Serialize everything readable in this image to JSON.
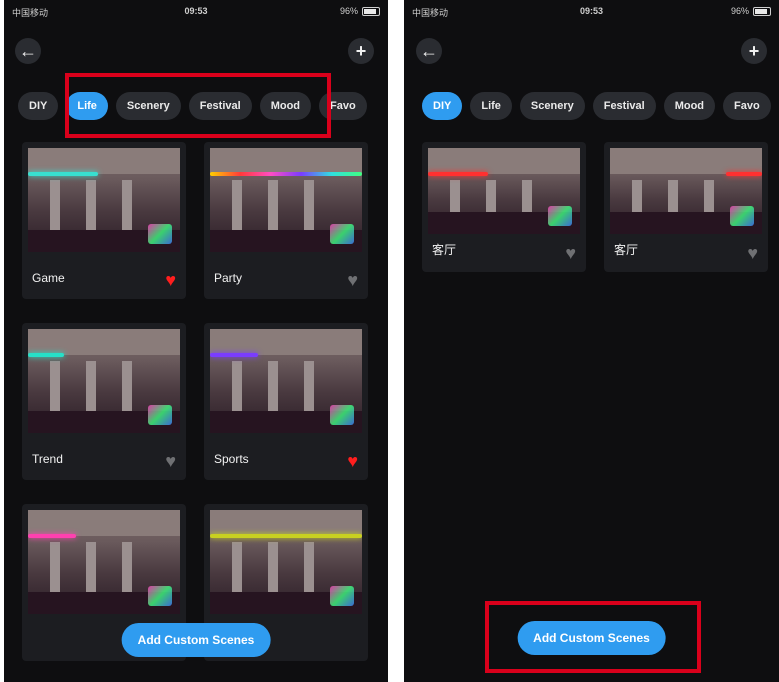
{
  "status_bar": {
    "carrier": "中国移动",
    "time": "09:53",
    "battery": "96%"
  },
  "header": {
    "back_icon": "←",
    "add_icon": "+"
  },
  "tabs": [
    "DIY",
    "Life",
    "Scenery",
    "Festival",
    "Mood",
    "Favo"
  ],
  "left_screen": {
    "active_tab": "Life",
    "scenes": [
      {
        "label": "Game",
        "favorite": true,
        "strip_color": "#38e0d0"
      },
      {
        "label": "Party",
        "favorite": false,
        "strip_color": "#ff4dc4"
      },
      {
        "label": "Trend",
        "favorite": false,
        "strip_color": "#26e0c8"
      },
      {
        "label": "Sports",
        "favorite": true,
        "strip_color": "#7a3cff"
      },
      {
        "label": "",
        "favorite": false,
        "strip_color": "#ff40b0"
      },
      {
        "label": "",
        "favorite": false,
        "strip_color": "#c8d020"
      }
    ],
    "add_button": "Add Custom Scenes"
  },
  "right_screen": {
    "active_tab": "DIY",
    "scenes": [
      {
        "label": "客厅",
        "favorite": false,
        "strip_color": "#ff3030"
      },
      {
        "label": "客厅",
        "favorite": false,
        "strip_color": "#ff3030"
      }
    ],
    "add_button": "Add Custom Scenes"
  },
  "colors": {
    "accent": "#2f9cf0",
    "highlight": "#d9001b",
    "favorite": "#ff1e1e",
    "background": "#0e0e10"
  }
}
